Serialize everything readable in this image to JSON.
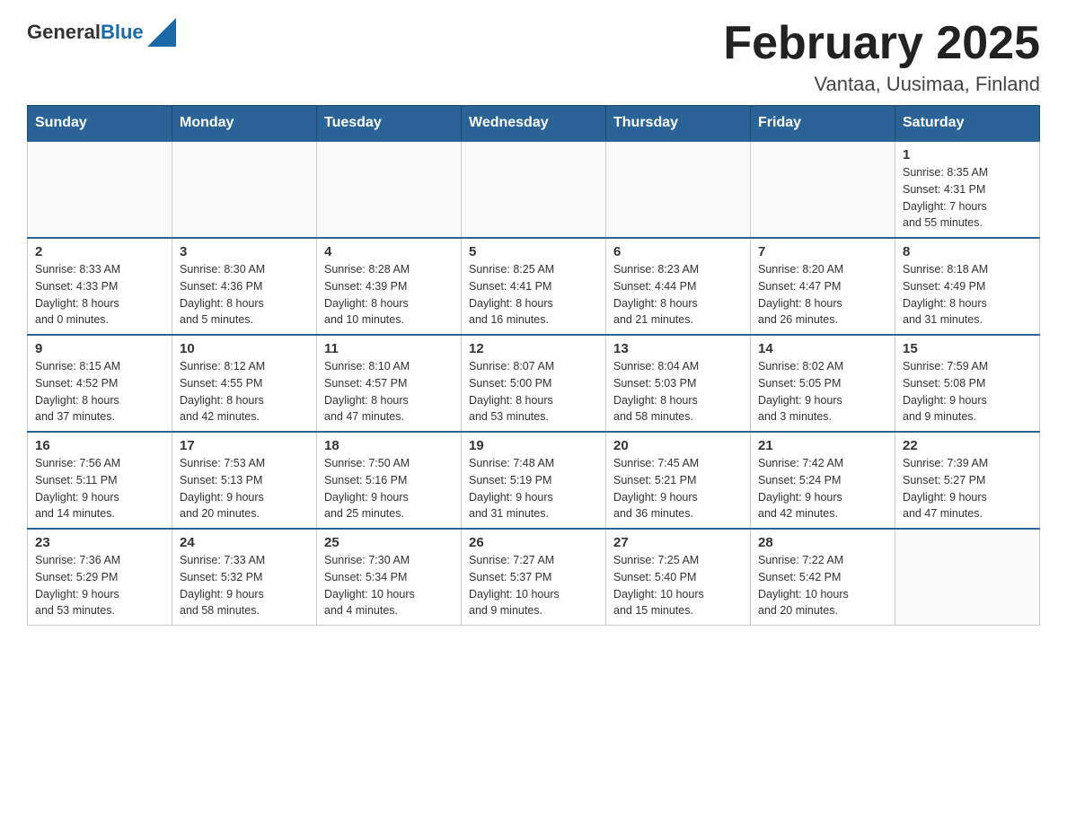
{
  "header": {
    "logo_general": "General",
    "logo_blue": "Blue",
    "month": "February 2025",
    "location": "Vantaa, Uusimaa, Finland"
  },
  "days_of_week": [
    "Sunday",
    "Monday",
    "Tuesday",
    "Wednesday",
    "Thursday",
    "Friday",
    "Saturday"
  ],
  "weeks": [
    [
      {
        "day": "",
        "info": ""
      },
      {
        "day": "",
        "info": ""
      },
      {
        "day": "",
        "info": ""
      },
      {
        "day": "",
        "info": ""
      },
      {
        "day": "",
        "info": ""
      },
      {
        "day": "",
        "info": ""
      },
      {
        "day": "1",
        "info": "Sunrise: 8:35 AM\nSunset: 4:31 PM\nDaylight: 7 hours\nand 55 minutes."
      }
    ],
    [
      {
        "day": "2",
        "info": "Sunrise: 8:33 AM\nSunset: 4:33 PM\nDaylight: 8 hours\nand 0 minutes."
      },
      {
        "day": "3",
        "info": "Sunrise: 8:30 AM\nSunset: 4:36 PM\nDaylight: 8 hours\nand 5 minutes."
      },
      {
        "day": "4",
        "info": "Sunrise: 8:28 AM\nSunset: 4:39 PM\nDaylight: 8 hours\nand 10 minutes."
      },
      {
        "day": "5",
        "info": "Sunrise: 8:25 AM\nSunset: 4:41 PM\nDaylight: 8 hours\nand 16 minutes."
      },
      {
        "day": "6",
        "info": "Sunrise: 8:23 AM\nSunset: 4:44 PM\nDaylight: 8 hours\nand 21 minutes."
      },
      {
        "day": "7",
        "info": "Sunrise: 8:20 AM\nSunset: 4:47 PM\nDaylight: 8 hours\nand 26 minutes."
      },
      {
        "day": "8",
        "info": "Sunrise: 8:18 AM\nSunset: 4:49 PM\nDaylight: 8 hours\nand 31 minutes."
      }
    ],
    [
      {
        "day": "9",
        "info": "Sunrise: 8:15 AM\nSunset: 4:52 PM\nDaylight: 8 hours\nand 37 minutes."
      },
      {
        "day": "10",
        "info": "Sunrise: 8:12 AM\nSunset: 4:55 PM\nDaylight: 8 hours\nand 42 minutes."
      },
      {
        "day": "11",
        "info": "Sunrise: 8:10 AM\nSunset: 4:57 PM\nDaylight: 8 hours\nand 47 minutes."
      },
      {
        "day": "12",
        "info": "Sunrise: 8:07 AM\nSunset: 5:00 PM\nDaylight: 8 hours\nand 53 minutes."
      },
      {
        "day": "13",
        "info": "Sunrise: 8:04 AM\nSunset: 5:03 PM\nDaylight: 8 hours\nand 58 minutes."
      },
      {
        "day": "14",
        "info": "Sunrise: 8:02 AM\nSunset: 5:05 PM\nDaylight: 9 hours\nand 3 minutes."
      },
      {
        "day": "15",
        "info": "Sunrise: 7:59 AM\nSunset: 5:08 PM\nDaylight: 9 hours\nand 9 minutes."
      }
    ],
    [
      {
        "day": "16",
        "info": "Sunrise: 7:56 AM\nSunset: 5:11 PM\nDaylight: 9 hours\nand 14 minutes."
      },
      {
        "day": "17",
        "info": "Sunrise: 7:53 AM\nSunset: 5:13 PM\nDaylight: 9 hours\nand 20 minutes."
      },
      {
        "day": "18",
        "info": "Sunrise: 7:50 AM\nSunset: 5:16 PM\nDaylight: 9 hours\nand 25 minutes."
      },
      {
        "day": "19",
        "info": "Sunrise: 7:48 AM\nSunset: 5:19 PM\nDaylight: 9 hours\nand 31 minutes."
      },
      {
        "day": "20",
        "info": "Sunrise: 7:45 AM\nSunset: 5:21 PM\nDaylight: 9 hours\nand 36 minutes."
      },
      {
        "day": "21",
        "info": "Sunrise: 7:42 AM\nSunset: 5:24 PM\nDaylight: 9 hours\nand 42 minutes."
      },
      {
        "day": "22",
        "info": "Sunrise: 7:39 AM\nSunset: 5:27 PM\nDaylight: 9 hours\nand 47 minutes."
      }
    ],
    [
      {
        "day": "23",
        "info": "Sunrise: 7:36 AM\nSunset: 5:29 PM\nDaylight: 9 hours\nand 53 minutes."
      },
      {
        "day": "24",
        "info": "Sunrise: 7:33 AM\nSunset: 5:32 PM\nDaylight: 9 hours\nand 58 minutes."
      },
      {
        "day": "25",
        "info": "Sunrise: 7:30 AM\nSunset: 5:34 PM\nDaylight: 10 hours\nand 4 minutes."
      },
      {
        "day": "26",
        "info": "Sunrise: 7:27 AM\nSunset: 5:37 PM\nDaylight: 10 hours\nand 9 minutes."
      },
      {
        "day": "27",
        "info": "Sunrise: 7:25 AM\nSunset: 5:40 PM\nDaylight: 10 hours\nand 15 minutes."
      },
      {
        "day": "28",
        "info": "Sunrise: 7:22 AM\nSunset: 5:42 PM\nDaylight: 10 hours\nand 20 minutes."
      },
      {
        "day": "",
        "info": ""
      }
    ]
  ]
}
